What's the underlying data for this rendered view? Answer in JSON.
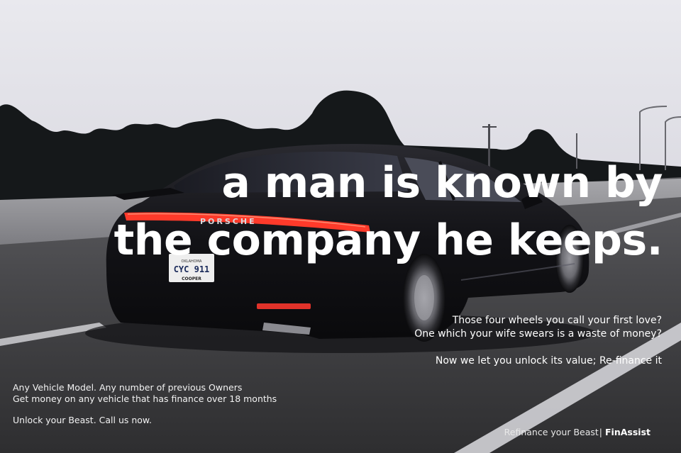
{
  "headline": {
    "line_1": "a man is known by",
    "line_2": "the company he keeps."
  },
  "body": {
    "question_1": "Those four wheels you call your first love?",
    "question_2": "One which your wife swears is a waste of money?",
    "unlock_value": "Now we let you unlock its value; Re-finance it"
  },
  "details": {
    "line_1": "Any Vehicle Model. Any number of previous Owners",
    "line_2": "Get money on any vehicle that has finance over 18 months",
    "line_3": "Unlock your Beast. Call us now."
  },
  "signature": {
    "tagline": "Refinance your Beast",
    "separator": "|",
    "brand": "FinAssist"
  },
  "vehicle": {
    "badge": "PORSCHE",
    "plate_state": "OKLAHOMA",
    "plate_number": "CYC 911",
    "plate_dealer": "COOPER"
  },
  "colors": {
    "sky": "#d4d3dc",
    "road": "#3a3a3c",
    "car_body": "#151518",
    "tail_light": "#ff3a2a",
    "text": "#ffffff"
  }
}
